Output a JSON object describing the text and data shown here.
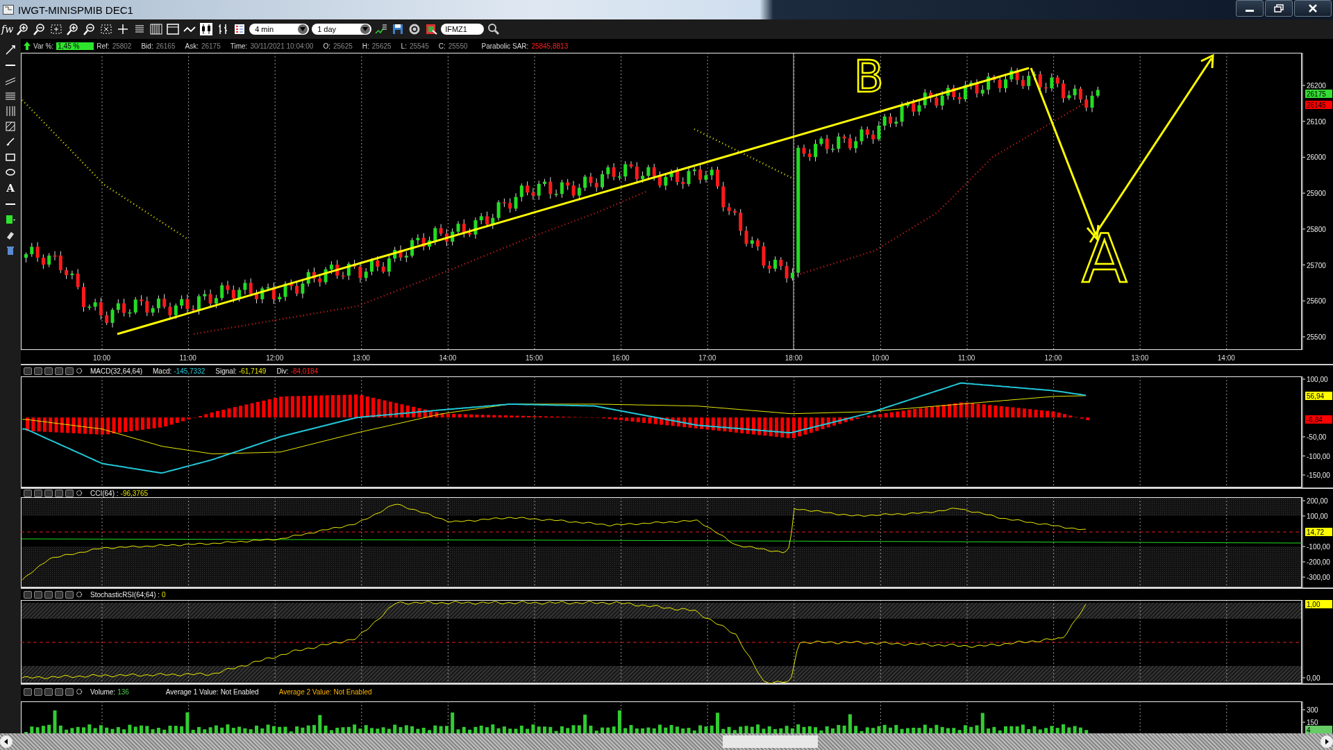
{
  "window": {
    "title": "IWGT-MINISPMIB DEC1"
  },
  "toolbar": {
    "function_label": "fw",
    "interval": "4 min",
    "range": "1 day",
    "symbol": "IFMZ1"
  },
  "quote_bar": {
    "var_label": "Var %:",
    "var_value": "1,45 %",
    "fields": [
      {
        "label": "Ref:",
        "value": "25802"
      },
      {
        "label": "Bid:",
        "value": "26165"
      },
      {
        "label": "Ask:",
        "value": "26175"
      },
      {
        "label": "Time:",
        "value": "30/11/2021 10:04:00"
      },
      {
        "label": "O:",
        "value": "25625"
      },
      {
        "label": "H:",
        "value": "25625"
      },
      {
        "label": "L:",
        "value": "25545"
      },
      {
        "label": "C:",
        "value": "25550"
      }
    ],
    "sar_label": "Parabolic SAR:",
    "sar_value": "25845,8813"
  },
  "drawing_tools": {
    "text_tool": "A"
  },
  "price_panel": {
    "time_axis": [
      "10:00",
      "11:00",
      "12:00",
      "13:00",
      "14:00",
      "15:00",
      "16:00",
      "17:00",
      "18:00",
      "10:00",
      "11:00",
      "12:00",
      "13:00",
      "14:00"
    ],
    "price_axis": [
      "26200",
      "26100",
      "26000",
      "25900",
      "25800",
      "25700",
      "25600",
      "25500"
    ],
    "price_tags": [
      {
        "value": "26175",
        "color": "#33dd33"
      },
      {
        "value": "26145",
        "color": "#ff0000"
      }
    ],
    "annotations": [
      "B",
      "A"
    ]
  },
  "macd": {
    "title": "MACD(32,64,64)",
    "macd_label": "Macd:",
    "macd_value": "-145,7332",
    "signal_label": "Signal:",
    "signal_value": "-61,7149",
    "div_label": "Div:",
    "div_value": "-84,0184",
    "axis": [
      "100,00",
      "-50,00",
      "-100,00",
      "-150,00"
    ],
    "tags": [
      {
        "value": "56,94",
        "color": "#ffff00"
      },
      {
        "value": "-6,84",
        "color": "#ff0000"
      }
    ]
  },
  "cci": {
    "title": "CCI(64) :",
    "value": "-96,3765",
    "axis": [
      "200,00",
      "100,00",
      "-100,00",
      "-200,00",
      "-300,00"
    ],
    "tag": "14,72"
  },
  "stoch": {
    "title": "StochasticRSI(64;64) :",
    "value": "0",
    "axis": [
      "0,00"
    ],
    "tag": "1,00"
  },
  "volume": {
    "title": "Volume:",
    "value": "136",
    "avg1_label": "Average 1 Value:",
    "avg1_value": "Not Enabled",
    "avg2_label": "Average 2 Value:",
    "avg2_value": "Not Enabled",
    "axis": [
      "300",
      "150"
    ],
    "tag": "4"
  }
}
